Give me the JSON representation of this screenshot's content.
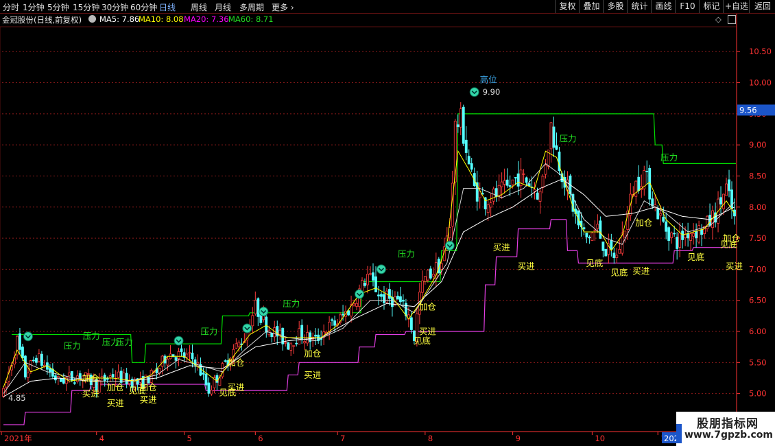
{
  "toolbar": {
    "periods": [
      "分时",
      "1分钟",
      "5分钟",
      "15分钟",
      "30分钟",
      "60分钟",
      "日线",
      "周线",
      "月线",
      "多周期",
      "更多"
    ],
    "active_period": "日线",
    "tools": [
      "复权",
      "叠加",
      "多股",
      "统计",
      "画线",
      "F10",
      "标记",
      "+自选",
      "返回"
    ]
  },
  "info": {
    "stock": "金冠股份(日线,前复权)",
    "ma5": "MA5: 7.86",
    "ma10": "MA10: 8.08",
    "ma20": "MA20: 7.36",
    "ma60": "MA60: 8.71"
  },
  "colors": {
    "up": "#ff3c3c",
    "down": "#54ffff",
    "ma5": "#ffffff",
    "ma10": "#ffff00",
    "ma20": "#ff00ff",
    "ma60": "#00ff00",
    "pressure": "#00e000",
    "support": "#e23ee2",
    "label_yellow": "#ffff40",
    "label_green": "#22dd22",
    "axis": "#ff3333",
    "grid": "#8b1a1a"
  },
  "watermark": {
    "title": "股朋指标网",
    "url": "www.7gpzb.com"
  },
  "chart_data": {
    "type": "candlestick",
    "ylim": [
      4.4,
      10.9
    ],
    "y_ticks": [
      5.0,
      5.5,
      6.0,
      6.5,
      7.0,
      7.5,
      8.0,
      8.5,
      9.0,
      9.5,
      10.0,
      10.5
    ],
    "y_tick_labels": [
      "5.00",
      "5.50",
      "6.00",
      "6.50",
      "7.00",
      "7.50",
      "8.00",
      "8.50",
      "9.00",
      "9.50",
      "10.00",
      "10.50"
    ],
    "current_price": "9.56",
    "current_price_value": 9.56,
    "x_months": [
      {
        "label": "2021年",
        "index": 0
      },
      {
        "label": "4",
        "index": 34
      },
      {
        "label": "5",
        "index": 66
      },
      {
        "label": "6",
        "index": 92
      },
      {
        "label": "7",
        "index": 122
      },
      {
        "label": "8",
        "index": 154
      },
      {
        "label": "9",
        "index": 186
      },
      {
        "label": "10",
        "index": 215
      },
      {
        "label": "11",
        "index": 239
      }
    ],
    "x_month_last_label": "202",
    "n_bars": 268,
    "price_path": [
      [
        0,
        5.0
      ],
      [
        5,
        5.85
      ],
      [
        8,
        5.3
      ],
      [
        12,
        5.6
      ],
      [
        20,
        5.2
      ],
      [
        28,
        5.3
      ],
      [
        34,
        5.15
      ],
      [
        40,
        5.3
      ],
      [
        50,
        5.15
      ],
      [
        56,
        5.35
      ],
      [
        60,
        5.65
      ],
      [
        66,
        5.6
      ],
      [
        70,
        5.55
      ],
      [
        75,
        5.05
      ],
      [
        80,
        5.4
      ],
      [
        84,
        5.7
      ],
      [
        88,
        5.9
      ],
      [
        92,
        6.4
      ],
      [
        96,
        6.1
      ],
      [
        100,
        5.95
      ],
      [
        104,
        5.8
      ],
      [
        108,
        5.95
      ],
      [
        114,
        5.85
      ],
      [
        118,
        6.05
      ],
      [
        122,
        6.15
      ],
      [
        127,
        6.4
      ],
      [
        133,
        6.9
      ],
      [
        138,
        6.55
      ],
      [
        144,
        6.5
      ],
      [
        148,
        6.25
      ],
      [
        150,
        5.9
      ],
      [
        152,
        6.6
      ],
      [
        154,
        6.85
      ],
      [
        160,
        7.1
      ],
      [
        163,
        7.7
      ],
      [
        165,
        9.3
      ],
      [
        167,
        9.4
      ],
      [
        170,
        8.7
      ],
      [
        172,
        8.3
      ],
      [
        176,
        8.1
      ],
      [
        180,
        8.2
      ],
      [
        184,
        8.3
      ],
      [
        188,
        8.5
      ],
      [
        192,
        8.4
      ],
      [
        196,
        8.2
      ],
      [
        200,
        9.3
      ],
      [
        203,
        8.7
      ],
      [
        206,
        8.3
      ],
      [
        210,
        7.7
      ],
      [
        213,
        7.5
      ],
      [
        217,
        7.65
      ],
      [
        220,
        7.3
      ],
      [
        224,
        7.2
      ],
      [
        227,
        7.7
      ],
      [
        230,
        8.3
      ],
      [
        234,
        8.55
      ],
      [
        238,
        8.0
      ],
      [
        242,
        7.65
      ],
      [
        246,
        7.45
      ],
      [
        250,
        7.6
      ],
      [
        256,
        7.65
      ],
      [
        260,
        7.9
      ],
      [
        264,
        8.3
      ],
      [
        267,
        7.8
      ]
    ],
    "candles": [],
    "ma5_path": [
      [
        0,
        5.1
      ],
      [
        5,
        5.7
      ],
      [
        10,
        5.35
      ],
      [
        16,
        5.45
      ],
      [
        24,
        5.2
      ],
      [
        32,
        5.25
      ],
      [
        40,
        5.25
      ],
      [
        48,
        5.2
      ],
      [
        54,
        5.3
      ],
      [
        60,
        5.6
      ],
      [
        66,
        5.6
      ],
      [
        72,
        5.4
      ],
      [
        78,
        5.2
      ],
      [
        84,
        5.6
      ],
      [
        90,
        5.95
      ],
      [
        96,
        6.1
      ],
      [
        102,
        5.9
      ],
      [
        108,
        5.9
      ],
      [
        116,
        5.9
      ],
      [
        122,
        6.1
      ],
      [
        130,
        6.6
      ],
      [
        136,
        6.7
      ],
      [
        142,
        6.55
      ],
      [
        148,
        6.2
      ],
      [
        152,
        6.45
      ],
      [
        158,
        6.9
      ],
      [
        162,
        7.4
      ],
      [
        166,
        8.9
      ],
      [
        170,
        8.6
      ],
      [
        176,
        8.1
      ],
      [
        182,
        8.2
      ],
      [
        188,
        8.4
      ],
      [
        194,
        8.3
      ],
      [
        198,
        8.9
      ],
      [
        202,
        8.8
      ],
      [
        208,
        8.0
      ],
      [
        212,
        7.6
      ],
      [
        218,
        7.6
      ],
      [
        222,
        7.3
      ],
      [
        226,
        7.55
      ],
      [
        230,
        8.2
      ],
      [
        236,
        8.4
      ],
      [
        242,
        7.8
      ],
      [
        248,
        7.55
      ],
      [
        256,
        7.65
      ],
      [
        264,
        8.1
      ],
      [
        267,
        7.9
      ]
    ],
    "ma10_path": [
      [
        0,
        5.0
      ],
      [
        8,
        5.5
      ],
      [
        16,
        5.35
      ],
      [
        26,
        5.25
      ],
      [
        36,
        5.2
      ],
      [
        46,
        5.2
      ],
      [
        56,
        5.3
      ],
      [
        64,
        5.55
      ],
      [
        72,
        5.45
      ],
      [
        80,
        5.35
      ],
      [
        88,
        5.7
      ],
      [
        96,
        6.0
      ],
      [
        104,
        5.9
      ],
      [
        114,
        5.85
      ],
      [
        124,
        6.05
      ],
      [
        134,
        6.5
      ],
      [
        142,
        6.5
      ],
      [
        150,
        6.3
      ],
      [
        156,
        6.7
      ],
      [
        162,
        7.1
      ],
      [
        168,
        8.3
      ],
      [
        174,
        8.3
      ],
      [
        182,
        8.15
      ],
      [
        190,
        8.3
      ],
      [
        198,
        8.7
      ],
      [
        204,
        8.5
      ],
      [
        212,
        7.8
      ],
      [
        220,
        7.5
      ],
      [
        226,
        7.4
      ],
      [
        234,
        8.1
      ],
      [
        242,
        7.9
      ],
      [
        250,
        7.6
      ],
      [
        258,
        7.7
      ],
      [
        267,
        8.08
      ]
    ],
    "ma20_path": [
      [
        0,
        4.95
      ],
      [
        10,
        5.2
      ],
      [
        20,
        5.25
      ],
      [
        32,
        5.2
      ],
      [
        44,
        5.2
      ],
      [
        56,
        5.25
      ],
      [
        68,
        5.45
      ],
      [
        80,
        5.4
      ],
      [
        92,
        5.75
      ],
      [
        104,
        5.85
      ],
      [
        116,
        5.9
      ],
      [
        128,
        6.2
      ],
      [
        140,
        6.45
      ],
      [
        150,
        6.4
      ],
      [
        160,
        6.8
      ],
      [
        168,
        7.6
      ],
      [
        176,
        7.8
      ],
      [
        186,
        8.0
      ],
      [
        196,
        8.3
      ],
      [
        204,
        8.45
      ],
      [
        212,
        8.2
      ],
      [
        220,
        7.85
      ],
      [
        230,
        7.9
      ],
      [
        238,
        8.0
      ],
      [
        248,
        7.85
      ],
      [
        258,
        7.8
      ],
      [
        267,
        8.0
      ]
    ],
    "pressure": {
      "label": "压力",
      "segments": [
        {
          "i0": 3,
          "i1": 47,
          "v": 5.95
        },
        {
          "i0": 47,
          "i1": 52,
          "v": 5.5
        },
        {
          "i0": 52,
          "i1": 80,
          "v": 5.8
        },
        {
          "i0": 80,
          "i1": 90,
          "v": 6.25
        },
        {
          "i0": 90,
          "i1": 122,
          "v": 6.3
        },
        {
          "i0": 122,
          "i1": 131,
          "v": 6.3
        },
        {
          "i0": 131,
          "i1": 160,
          "v": 6.8
        },
        {
          "i0": 160,
          "i1": 166,
          "v": 7.3
        },
        {
          "i0": 166,
          "i1": 238,
          "v": 9.5
        },
        {
          "i0": 238,
          "i1": 241,
          "v": 9.0
        },
        {
          "i0": 241,
          "i1": 268,
          "v": 8.7
        }
      ],
      "labels_at": [
        {
          "i": 25,
          "v": 5.72
        },
        {
          "i": 32,
          "v": 5.88
        },
        {
          "i": 39,
          "v": 5.78
        },
        {
          "i": 44,
          "v": 5.78
        },
        {
          "i": 75,
          "v": 5.95
        },
        {
          "i": 105,
          "v": 6.4
        },
        {
          "i": 147,
          "v": 7.2
        },
        {
          "i": 206,
          "v": 9.05
        },
        {
          "i": 243,
          "v": 8.75
        }
      ]
    },
    "support": {
      "segments": [
        {
          "i0": 0,
          "i1": 8,
          "v": 4.5
        },
        {
          "i0": 8,
          "i1": 12,
          "v": 4.7
        },
        {
          "i0": 12,
          "i1": 25,
          "v": 4.7
        },
        {
          "i0": 25,
          "i1": 32,
          "v": 5.05
        },
        {
          "i0": 32,
          "i1": 60,
          "v": 5.15
        },
        {
          "i0": 60,
          "i1": 74,
          "v": 5.15
        },
        {
          "i0": 74,
          "i1": 104,
          "v": 5.05
        },
        {
          "i0": 104,
          "i1": 108,
          "v": 5.3
        },
        {
          "i0": 108,
          "i1": 130,
          "v": 5.5
        },
        {
          "i0": 130,
          "i1": 136,
          "v": 5.75
        },
        {
          "i0": 136,
          "i1": 147,
          "v": 5.95
        },
        {
          "i0": 147,
          "i1": 176,
          "v": 6.0
        },
        {
          "i0": 176,
          "i1": 180,
          "v": 6.75
        },
        {
          "i0": 180,
          "i1": 188,
          "v": 7.2
        },
        {
          "i0": 188,
          "i1": 200,
          "v": 7.65
        },
        {
          "i0": 200,
          "i1": 206,
          "v": 7.8
        },
        {
          "i0": 206,
          "i1": 210,
          "v": 7.3
        },
        {
          "i0": 210,
          "i1": 245,
          "v": 7.1
        },
        {
          "i0": 245,
          "i1": 252,
          "v": 7.3
        },
        {
          "i0": 252,
          "i1": 268,
          "v": 7.35
        }
      ]
    },
    "annotations": [
      {
        "text": "买进",
        "i": 32,
        "v": 4.95,
        "color": "label_yellow"
      },
      {
        "text": "买进",
        "i": 41,
        "v": 4.8,
        "color": "label_yellow"
      },
      {
        "text": "买进",
        "i": 53,
        "v": 4.85,
        "color": "label_yellow"
      },
      {
        "text": "加仓",
        "i": 32,
        "v": 5.2,
        "color": "label_yellow"
      },
      {
        "text": "加仓",
        "i": 41,
        "v": 5.05,
        "color": "label_yellow"
      },
      {
        "text": "加仓",
        "i": 53,
        "v": 5.05,
        "color": "label_yellow"
      },
      {
        "text": "见底",
        "i": 49,
        "v": 5.0,
        "color": "label_yellow"
      },
      {
        "text": "买进",
        "i": 85,
        "v": 5.05,
        "color": "label_yellow"
      },
      {
        "text": "见底",
        "i": 82,
        "v": 4.97,
        "color": "label_yellow"
      },
      {
        "text": "加仓",
        "i": 85,
        "v": 5.45,
        "color": "label_yellow"
      },
      {
        "text": "加仓",
        "i": 113,
        "v": 5.6,
        "color": "label_yellow"
      },
      {
        "text": "买进",
        "i": 113,
        "v": 5.25,
        "color": "label_yellow"
      },
      {
        "text": "加仓",
        "i": 155,
        "v": 6.35,
        "color": "label_yellow"
      },
      {
        "text": "买进",
        "i": 155,
        "v": 5.95,
        "color": "label_yellow"
      },
      {
        "text": "见底",
        "i": 153,
        "v": 5.8,
        "color": "label_yellow"
      },
      {
        "text": "买进",
        "i": 182,
        "v": 7.3,
        "color": "label_yellow"
      },
      {
        "text": "买进",
        "i": 191,
        "v": 7.0,
        "color": "label_yellow"
      },
      {
        "text": "见底",
        "i": 216,
        "v": 7.05,
        "color": "label_yellow"
      },
      {
        "text": "见底",
        "i": 225,
        "v": 6.9,
        "color": "label_yellow"
      },
      {
        "text": "买进",
        "i": 233,
        "v": 6.92,
        "color": "label_yellow"
      },
      {
        "text": "加仓",
        "i": 234,
        "v": 7.7,
        "color": "label_yellow"
      },
      {
        "text": "见底",
        "i": 253,
        "v": 7.15,
        "color": "label_yellow"
      },
      {
        "text": "见底",
        "i": 265,
        "v": 7.35,
        "color": "label_yellow"
      },
      {
        "text": "加仓",
        "i": 266,
        "v": 7.45,
        "color": "label_yellow"
      },
      {
        "text": "买进",
        "i": 267,
        "v": 7.0,
        "color": "label_yellow"
      }
    ],
    "markers": [
      {
        "i": 9,
        "v": 5.92
      },
      {
        "i": 64,
        "v": 5.85
      },
      {
        "i": 89,
        "v": 6.05
      },
      {
        "i": 95,
        "v": 6.32
      },
      {
        "i": 130,
        "v": 6.6
      },
      {
        "i": 138,
        "v": 7.0
      },
      {
        "i": 163,
        "v": 7.38
      },
      {
        "i": 172,
        "v": 9.85
      }
    ],
    "high_label": {
      "text": "高位",
      "i": 176,
      "v": 10.0
    },
    "high_value": {
      "text": "9.90",
      "i": 174,
      "v": 9.85
    },
    "low_value": {
      "text": "4.85",
      "i": 0,
      "v": 4.85
    }
  }
}
